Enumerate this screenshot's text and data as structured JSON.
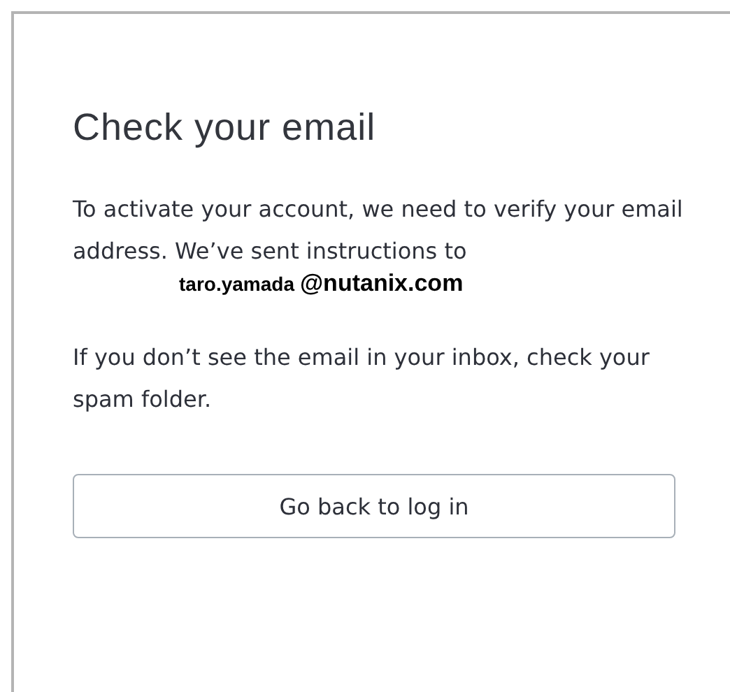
{
  "heading": "Check your email",
  "message": "To activate your account, we need to verify your email address. We’ve sent instructions to",
  "email": {
    "user": "taro.yamada",
    "domain": "@nutanix.com"
  },
  "hint": "If you don’t see the email in your inbox, check your spam folder.",
  "button": {
    "label": "Go back to log in"
  }
}
